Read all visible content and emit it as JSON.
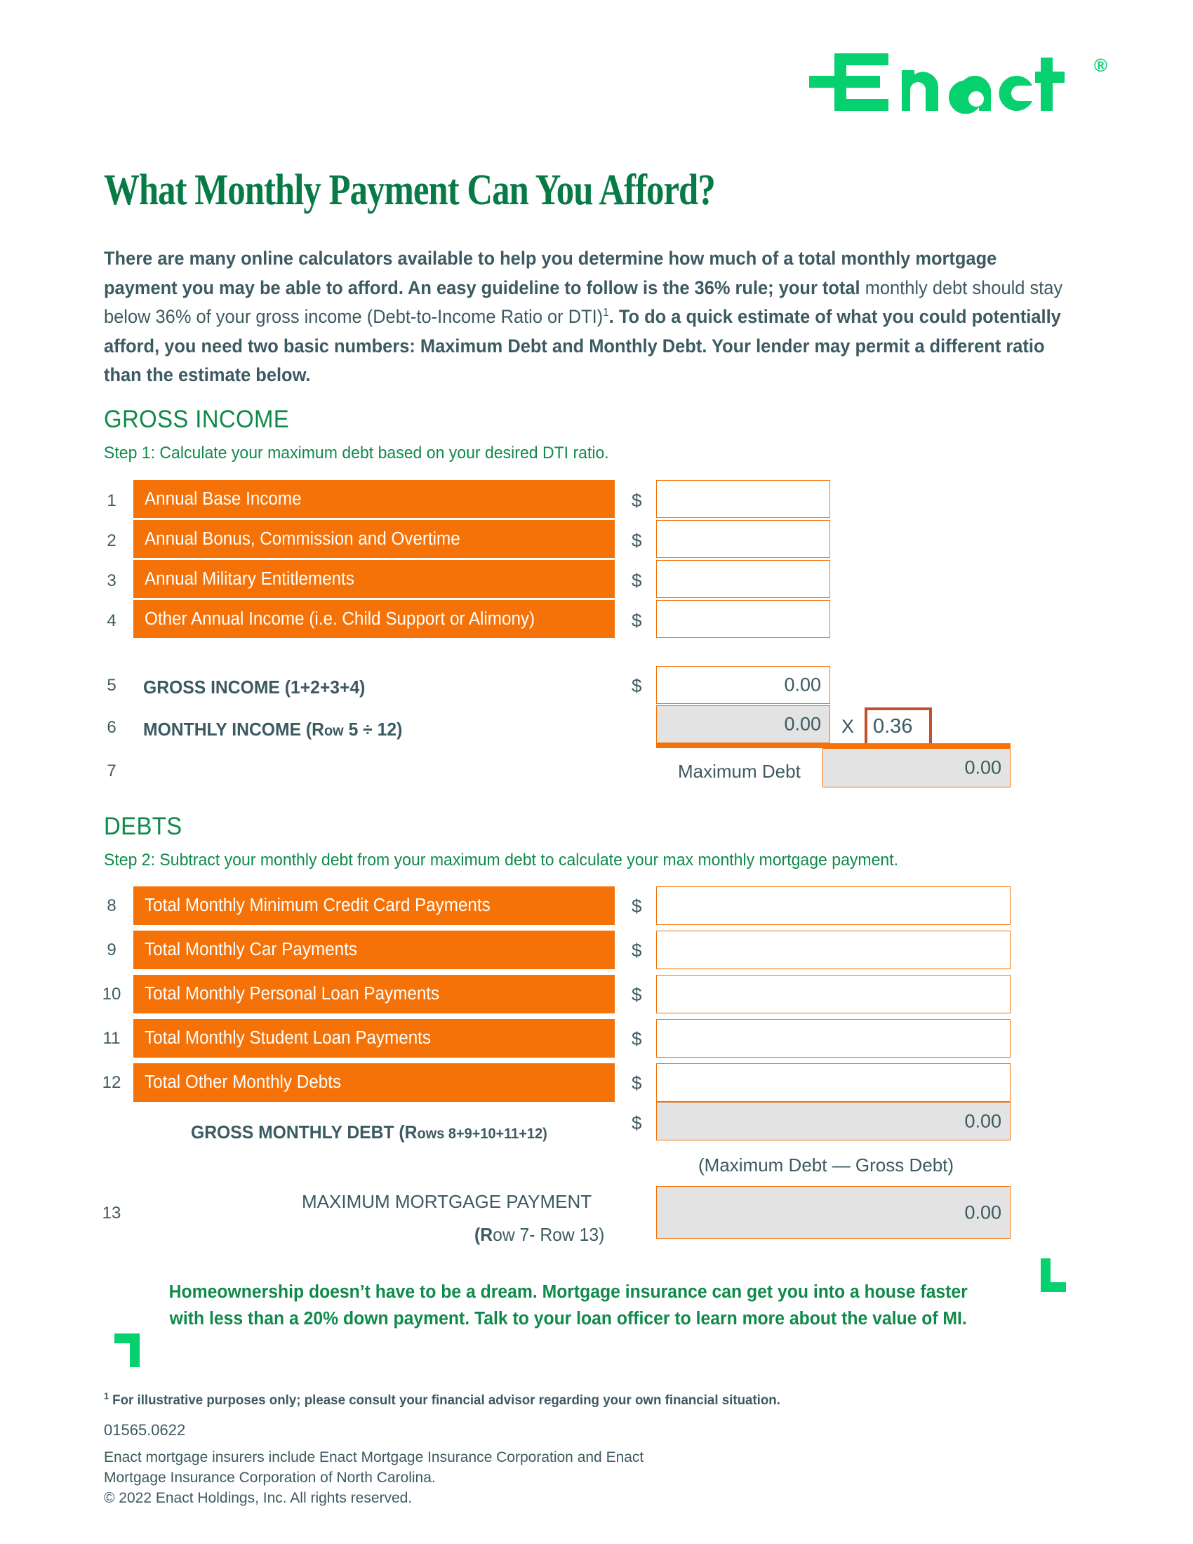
{
  "brand": {
    "logo_text": "Enact",
    "registered_mark": "®",
    "green": "#07d16e",
    "dark_green": "#0f8a4a",
    "headline_green": "#077a46",
    "orange": "#F57208",
    "rust": "#C0522B",
    "slate": "#3c5a61",
    "gray_fill": "#e3e3e3"
  },
  "headline": "What Monthly Payment Can You Afford?",
  "intro": {
    "part1_bold": "There are many online calculators available to help you determine how much of a total monthly mortgage payment you may be able to afford. An easy guideline to follow is the 36% rule; your total",
    "part2_regular": " monthly debt should stay below 36% of your gross income (Debt-to-Income Ratio or DTI)",
    "footnote_marker": "1",
    "part3_bold": ". To do a quick estimate of what you could potentially afford, you need two basic numbers: Maximum Debt and Monthly Debt. Your lender may permit a different ratio than the estimate below."
  },
  "gross_income": {
    "title": "GROSS INCOME",
    "step": "Step 1: Calculate your maximum debt based on your desired DTI ratio.",
    "dollar_sign": "$",
    "rows": [
      {
        "num": "1",
        "label": "Annual Base Income",
        "value": ""
      },
      {
        "num": "2",
        "label": "Annual Bonus, Commission and Overtime",
        "value": ""
      },
      {
        "num": "3",
        "label": "Annual Military Entitlements",
        "value": ""
      },
      {
        "num": "4",
        "label": "Other Annual Income (i.e. Child Support or Alimony)",
        "value": ""
      }
    ],
    "row5": {
      "num": "5",
      "label": "GROSS INCOME (1+2+3+4)",
      "value": "0.00"
    },
    "row6": {
      "num": "6",
      "label_main": "MONTHLY INCOME (",
      "label_row": "R",
      "label_row_small": "ow",
      "label_tail": " 5 ÷ 12)",
      "value": "0.00",
      "multiplier_symbol": "X",
      "multiplier_value": "0.36"
    },
    "row7": {
      "num": "7",
      "label": "Maximum Debt",
      "value": "0.00"
    }
  },
  "debts": {
    "title": "DEBTS",
    "step": "Step 2: Subtract your monthly debt from your maximum debt to calculate your max monthly mortgage payment.",
    "dollar_sign": "$",
    "rows": [
      {
        "num": "8",
        "label": "Total Monthly Minimum Credit Card Payments",
        "value": ""
      },
      {
        "num": "9",
        "label": "Total Monthly Car Payments",
        "value": ""
      },
      {
        "num": "10",
        "label": "Total Monthly Personal Loan Payments",
        "value": ""
      },
      {
        "num": "11",
        "label": "Total Monthly Student Loan Payments",
        "value": ""
      },
      {
        "num": "12",
        "label": "Total Other Monthly Debts",
        "value": ""
      }
    ],
    "gross_monthly_debt": {
      "label_lead": "GROSS MONTHLY DEBT  (",
      "label_row": "R",
      "label_row_small": "ows",
      "label_tail": "  8+9+10+11+12)",
      "value": "0.00"
    },
    "formula_note": "(Maximum Debt — Gross Debt)",
    "max_mortgage": {
      "num": "13",
      "label_line1": "MAXIMUM MORTGAGE PAYMENT",
      "label_line2_bold_r": "R",
      "label_line2": "ow 7- Row 13)",
      "value": "0.00"
    }
  },
  "green_message": "Homeownership doesn’t have to be a dream. Mortgage insurance can get you into a house faster with less than a 20% down payment. Talk to your loan officer to learn more about the value of MI.",
  "footer": {
    "footnote_marker": "1",
    "footnote": " For illustrative purposes only; please consult your financial advisor regarding your own financial situation.",
    "code": "01565.0622",
    "legal": "Enact mortgage insurers include Enact Mortgage Insurance Corporation and Enact\nMortgage Insurance Corporation of North Carolina.\n© 2022 Enact Holdings, Inc. All rights reserved."
  }
}
